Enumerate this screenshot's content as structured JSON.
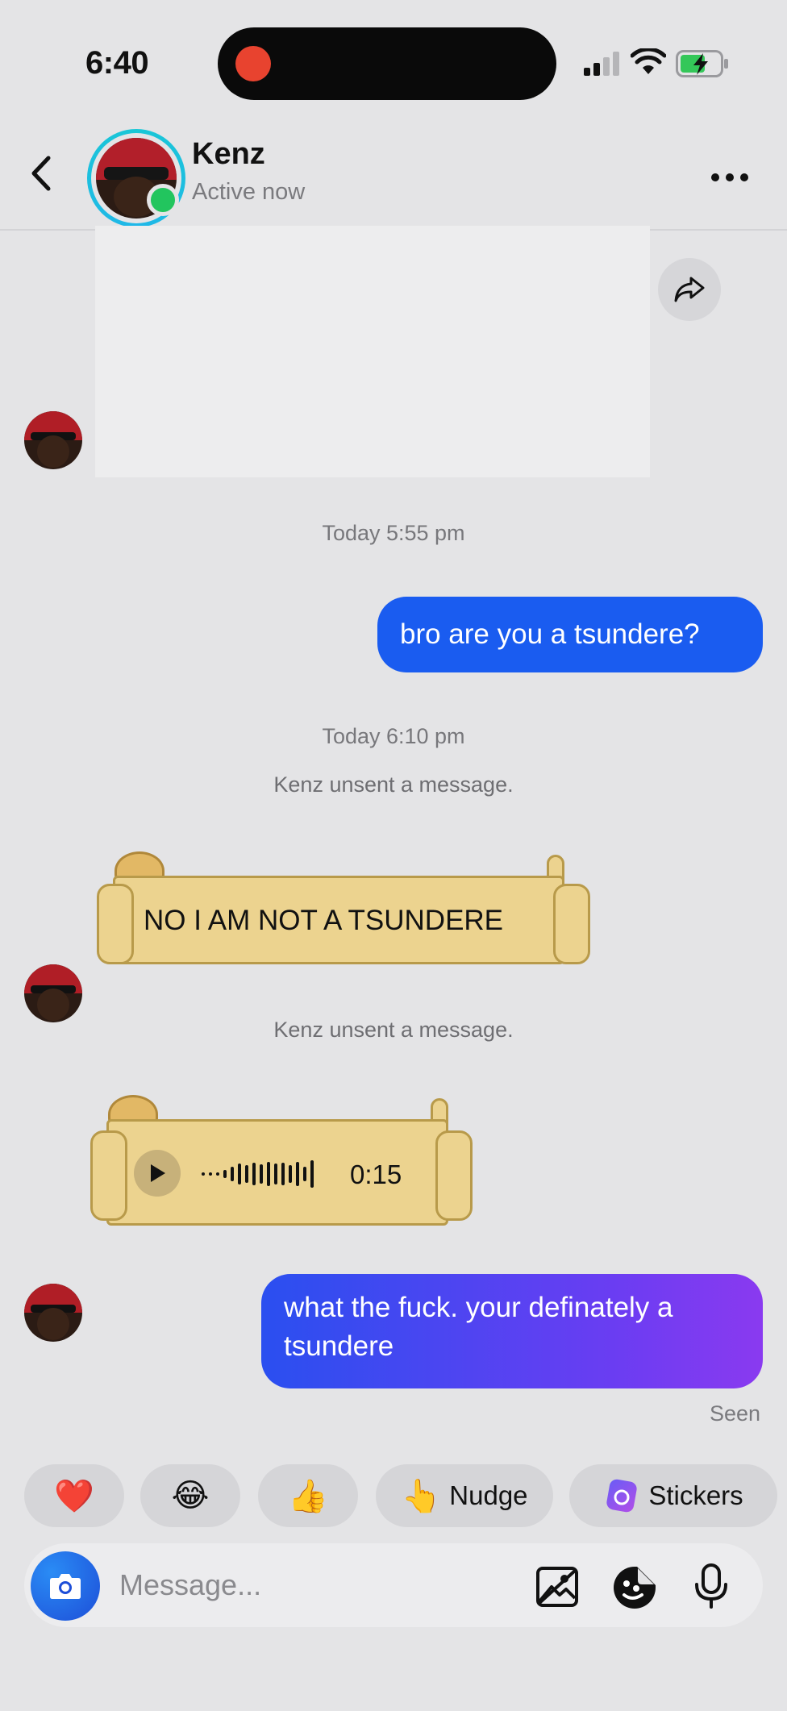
{
  "status_bar": {
    "time": "6:40"
  },
  "header": {
    "contact_name": "Kenz",
    "contact_status": "Active now"
  },
  "conversation": {
    "timestamp_1": "Today 5:55 pm",
    "outgoing_1": "bro are you a tsundere?",
    "timestamp_2": "Today 6:10 pm",
    "system_1": "Kenz unsent a message.",
    "sticker_text": "NO I AM NOT A TSUNDERE",
    "system_2": "Kenz unsent a message.",
    "voice_duration": "0:15",
    "outgoing_2": "what the fuck. your definately a tsundere",
    "seen_label": "Seen"
  },
  "quick_reactions": {
    "heart": "❤️",
    "laugh": "😂",
    "thumbs_up": "👍",
    "nudge_emoji": "👆",
    "nudge_label": "Nudge",
    "stickers_label": "Stickers"
  },
  "composer": {
    "placeholder": "Message..."
  },
  "colors": {
    "outgoing_bubble": "#1a5cf0",
    "outgoing_gradient_end": "#8a3af0",
    "active_dot": "#22c55e",
    "story_ring": "#19c7d6",
    "background": "#e4e4e6"
  }
}
